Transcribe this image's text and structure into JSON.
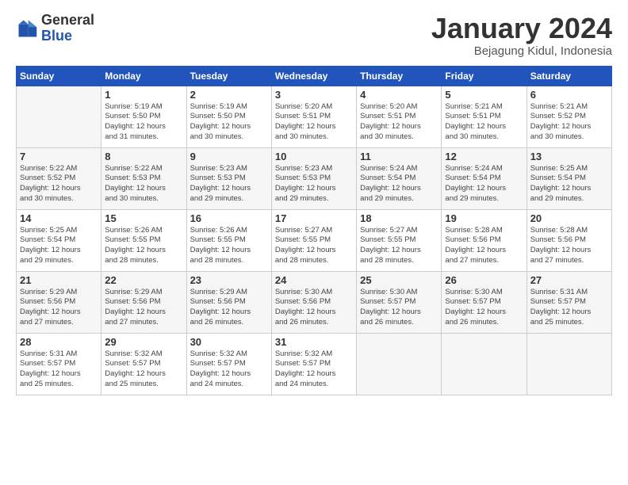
{
  "logo": {
    "general": "General",
    "blue": "Blue"
  },
  "title": "January 2024",
  "subtitle": "Bejagung Kidul, Indonesia",
  "days_of_week": [
    "Sunday",
    "Monday",
    "Tuesday",
    "Wednesday",
    "Thursday",
    "Friday",
    "Saturday"
  ],
  "weeks": [
    [
      {
        "num": "",
        "sunrise": "",
        "sunset": "",
        "daylight": ""
      },
      {
        "num": "1",
        "sunrise": "Sunrise: 5:19 AM",
        "sunset": "Sunset: 5:50 PM",
        "daylight": "Daylight: 12 hours and 31 minutes."
      },
      {
        "num": "2",
        "sunrise": "Sunrise: 5:19 AM",
        "sunset": "Sunset: 5:50 PM",
        "daylight": "Daylight: 12 hours and 30 minutes."
      },
      {
        "num": "3",
        "sunrise": "Sunrise: 5:20 AM",
        "sunset": "Sunset: 5:51 PM",
        "daylight": "Daylight: 12 hours and 30 minutes."
      },
      {
        "num": "4",
        "sunrise": "Sunrise: 5:20 AM",
        "sunset": "Sunset: 5:51 PM",
        "daylight": "Daylight: 12 hours and 30 minutes."
      },
      {
        "num": "5",
        "sunrise": "Sunrise: 5:21 AM",
        "sunset": "Sunset: 5:51 PM",
        "daylight": "Daylight: 12 hours and 30 minutes."
      },
      {
        "num": "6",
        "sunrise": "Sunrise: 5:21 AM",
        "sunset": "Sunset: 5:52 PM",
        "daylight": "Daylight: 12 hours and 30 minutes."
      }
    ],
    [
      {
        "num": "7",
        "sunrise": "Sunrise: 5:22 AM",
        "sunset": "Sunset: 5:52 PM",
        "daylight": "Daylight: 12 hours and 30 minutes."
      },
      {
        "num": "8",
        "sunrise": "Sunrise: 5:22 AM",
        "sunset": "Sunset: 5:53 PM",
        "daylight": "Daylight: 12 hours and 30 minutes."
      },
      {
        "num": "9",
        "sunrise": "Sunrise: 5:23 AM",
        "sunset": "Sunset: 5:53 PM",
        "daylight": "Daylight: 12 hours and 29 minutes."
      },
      {
        "num": "10",
        "sunrise": "Sunrise: 5:23 AM",
        "sunset": "Sunset: 5:53 PM",
        "daylight": "Daylight: 12 hours and 29 minutes."
      },
      {
        "num": "11",
        "sunrise": "Sunrise: 5:24 AM",
        "sunset": "Sunset: 5:54 PM",
        "daylight": "Daylight: 12 hours and 29 minutes."
      },
      {
        "num": "12",
        "sunrise": "Sunrise: 5:24 AM",
        "sunset": "Sunset: 5:54 PM",
        "daylight": "Daylight: 12 hours and 29 minutes."
      },
      {
        "num": "13",
        "sunrise": "Sunrise: 5:25 AM",
        "sunset": "Sunset: 5:54 PM",
        "daylight": "Daylight: 12 hours and 29 minutes."
      }
    ],
    [
      {
        "num": "14",
        "sunrise": "Sunrise: 5:25 AM",
        "sunset": "Sunset: 5:54 PM",
        "daylight": "Daylight: 12 hours and 29 minutes."
      },
      {
        "num": "15",
        "sunrise": "Sunrise: 5:26 AM",
        "sunset": "Sunset: 5:55 PM",
        "daylight": "Daylight: 12 hours and 28 minutes."
      },
      {
        "num": "16",
        "sunrise": "Sunrise: 5:26 AM",
        "sunset": "Sunset: 5:55 PM",
        "daylight": "Daylight: 12 hours and 28 minutes."
      },
      {
        "num": "17",
        "sunrise": "Sunrise: 5:27 AM",
        "sunset": "Sunset: 5:55 PM",
        "daylight": "Daylight: 12 hours and 28 minutes."
      },
      {
        "num": "18",
        "sunrise": "Sunrise: 5:27 AM",
        "sunset": "Sunset: 5:55 PM",
        "daylight": "Daylight: 12 hours and 28 minutes."
      },
      {
        "num": "19",
        "sunrise": "Sunrise: 5:28 AM",
        "sunset": "Sunset: 5:56 PM",
        "daylight": "Daylight: 12 hours and 27 minutes."
      },
      {
        "num": "20",
        "sunrise": "Sunrise: 5:28 AM",
        "sunset": "Sunset: 5:56 PM",
        "daylight": "Daylight: 12 hours and 27 minutes."
      }
    ],
    [
      {
        "num": "21",
        "sunrise": "Sunrise: 5:29 AM",
        "sunset": "Sunset: 5:56 PM",
        "daylight": "Daylight: 12 hours and 27 minutes."
      },
      {
        "num": "22",
        "sunrise": "Sunrise: 5:29 AM",
        "sunset": "Sunset: 5:56 PM",
        "daylight": "Daylight: 12 hours and 27 minutes."
      },
      {
        "num": "23",
        "sunrise": "Sunrise: 5:29 AM",
        "sunset": "Sunset: 5:56 PM",
        "daylight": "Daylight: 12 hours and 26 minutes."
      },
      {
        "num": "24",
        "sunrise": "Sunrise: 5:30 AM",
        "sunset": "Sunset: 5:56 PM",
        "daylight": "Daylight: 12 hours and 26 minutes."
      },
      {
        "num": "25",
        "sunrise": "Sunrise: 5:30 AM",
        "sunset": "Sunset: 5:57 PM",
        "daylight": "Daylight: 12 hours and 26 minutes."
      },
      {
        "num": "26",
        "sunrise": "Sunrise: 5:30 AM",
        "sunset": "Sunset: 5:57 PM",
        "daylight": "Daylight: 12 hours and 26 minutes."
      },
      {
        "num": "27",
        "sunrise": "Sunrise: 5:31 AM",
        "sunset": "Sunset: 5:57 PM",
        "daylight": "Daylight: 12 hours and 25 minutes."
      }
    ],
    [
      {
        "num": "28",
        "sunrise": "Sunrise: 5:31 AM",
        "sunset": "Sunset: 5:57 PM",
        "daylight": "Daylight: 12 hours and 25 minutes."
      },
      {
        "num": "29",
        "sunrise": "Sunrise: 5:32 AM",
        "sunset": "Sunset: 5:57 PM",
        "daylight": "Daylight: 12 hours and 25 minutes."
      },
      {
        "num": "30",
        "sunrise": "Sunrise: 5:32 AM",
        "sunset": "Sunset: 5:57 PM",
        "daylight": "Daylight: 12 hours and 24 minutes."
      },
      {
        "num": "31",
        "sunrise": "Sunrise: 5:32 AM",
        "sunset": "Sunset: 5:57 PM",
        "daylight": "Daylight: 12 hours and 24 minutes."
      },
      {
        "num": "",
        "sunrise": "",
        "sunset": "",
        "daylight": ""
      },
      {
        "num": "",
        "sunrise": "",
        "sunset": "",
        "daylight": ""
      },
      {
        "num": "",
        "sunrise": "",
        "sunset": "",
        "daylight": ""
      }
    ]
  ]
}
